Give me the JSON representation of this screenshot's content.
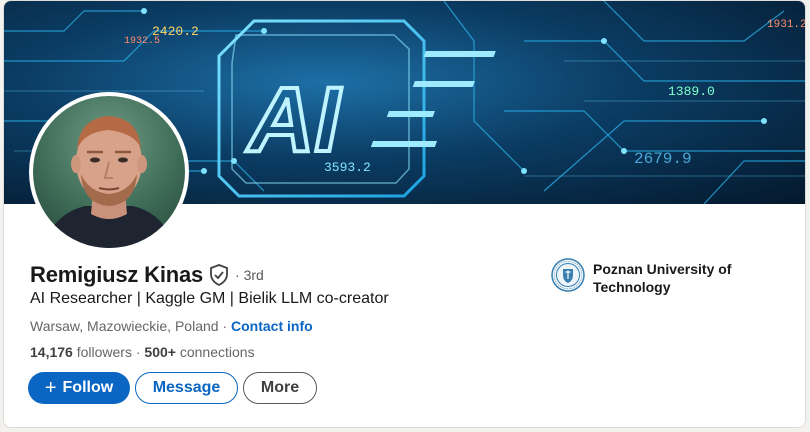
{
  "profile": {
    "name": "Remigiusz Kinas",
    "degree": "· 3rd",
    "headline": "AI Researcher | Kaggle GM | Bielik LLM co-creator",
    "location": "Warsaw, Mazowieckie, Poland",
    "location_separator": " · ",
    "contact_label": "Contact info",
    "followers_count": "14,176",
    "followers_label": " followers",
    "connections_sep": " · ",
    "connections_count": "500+",
    "connections_label": " connections"
  },
  "actions": {
    "follow_label": "Follow",
    "message_label": "Message",
    "more_label": "More"
  },
  "education": {
    "name": "Poznan University of Technology"
  },
  "banner": {
    "big_text": "AI",
    "numbers": [
      "2420.2",
      "1932.5",
      "3593.2",
      "1389.0",
      "2679.9",
      "1931.2"
    ]
  },
  "icons": {
    "verified": "shield-check-icon",
    "plus": "plus-icon",
    "university_logo": "university-seal-icon"
  },
  "colors": {
    "primary": "#0a66c2",
    "text": "#191919",
    "muted": "#666666"
  }
}
